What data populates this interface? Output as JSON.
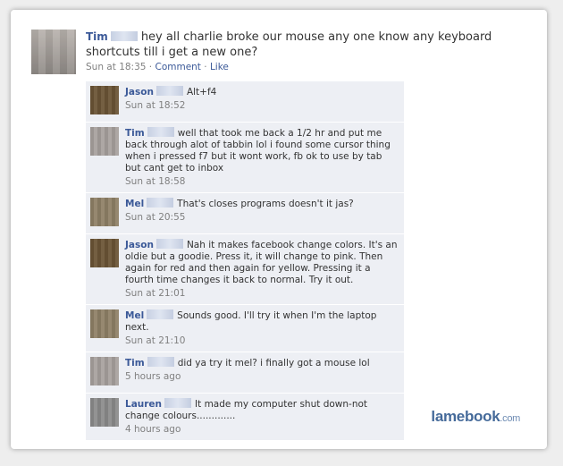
{
  "post": {
    "author": "Tim",
    "text": "hey all charlie broke our mouse any one know any keyboard shortcuts till i get a new one?",
    "time": "Sun at 18:35",
    "sep1": " · ",
    "comment_label": "Comment",
    "sep2": " · ",
    "like_label": "Like"
  },
  "comments": [
    {
      "author": "Jason",
      "text": "Alt+f4",
      "time": "Sun at 18:52",
      "avatar_color": "#6b5536"
    },
    {
      "author": "Tim",
      "text": "well that took me back a 1/2 hr and put me back through alot of tabbin lol i found some cursor thing when i pressed f7 but it wont work, fb ok to use by tab but cant get to inbox",
      "time": "Sun at 18:58",
      "avatar_color": "#a8a29e"
    },
    {
      "author": "Mel",
      "text": "That's closes programs doesn't it jas?",
      "time": "Sun at 20:55",
      "avatar_color": "#8f8167"
    },
    {
      "author": "Jason",
      "text": "Nah it makes facebook change colors. It's an oldie but a goodie. Press it, it will change to pink. Then again for red and then again for yellow. Pressing it a fourth time changes it back to normal. Try it out.",
      "time": "Sun at 21:01",
      "avatar_color": "#6b5536"
    },
    {
      "author": "Mel",
      "text": "Sounds good. I'll try it when I'm the laptop next.",
      "time": "Sun at 21:10",
      "avatar_color": "#8f8167"
    },
    {
      "author": "Tim",
      "text": "did ya try it mel? i finally got a mouse lol",
      "time": "5 hours ago",
      "avatar_color": "#a8a29e"
    },
    {
      "author": "Lauren",
      "text": "It made my computer shut down-not change colours.............",
      "time": "4 hours ago",
      "avatar_color": "#8c8c8c"
    }
  ],
  "watermark": {
    "brand": "lamebook",
    "domain": ".com"
  }
}
